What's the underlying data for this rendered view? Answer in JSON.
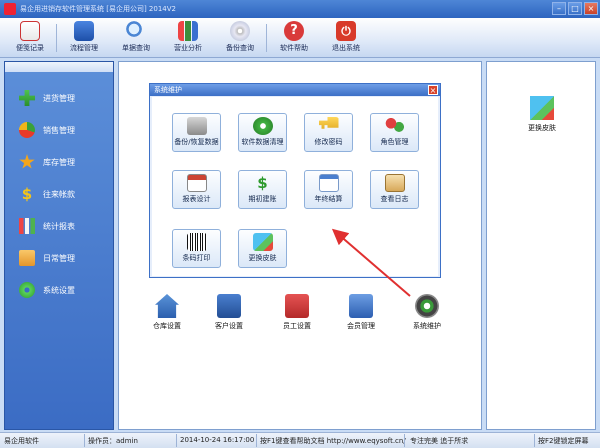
{
  "titlebar": {
    "title": "易企用进销存软件管理系统 [易企用公司] 2014V2"
  },
  "toolbar": {
    "buttons": [
      {
        "label": "便笺记录",
        "icon": "notepad-icon"
      },
      {
        "label": "流程管理",
        "icon": "flow-icon"
      },
      {
        "label": "单据查询",
        "icon": "search-icon"
      },
      {
        "label": "营业分析",
        "icon": "chart-icon"
      },
      {
        "label": "备份查询",
        "icon": "disc-icon"
      },
      {
        "label": "软件帮助",
        "icon": "help-icon"
      },
      {
        "label": "退出系统",
        "icon": "power-icon"
      }
    ]
  },
  "sidebar": {
    "items": [
      {
        "label": "进货管理",
        "icon": "plus-icon"
      },
      {
        "label": "销售管理",
        "icon": "pie-icon"
      },
      {
        "label": "库存管理",
        "icon": "star-icon"
      },
      {
        "label": "往来帐款",
        "icon": "dollar-icon"
      },
      {
        "label": "统计报表",
        "icon": "bar-chart-icon"
      },
      {
        "label": "日常管理",
        "icon": "folder-icon"
      },
      {
        "label": "系统设置",
        "icon": "gear-icon"
      }
    ]
  },
  "dialog": {
    "title": "系统维护",
    "close": "×",
    "buttons": [
      {
        "label": "备份/恢复数据",
        "icon": "database-icon"
      },
      {
        "label": "软件数据清理",
        "icon": "cleanup-icon"
      },
      {
        "label": "修改密码",
        "icon": "key-icon"
      },
      {
        "label": "角色管理",
        "icon": "users-icon"
      },
      {
        "label": "报表设计",
        "icon": "report-icon"
      },
      {
        "label": "期初建账",
        "icon": "money-icon"
      },
      {
        "label": "年终结算",
        "icon": "calendar-icon"
      },
      {
        "label": "查看日志",
        "icon": "log-icon"
      },
      {
        "label": "条码打印",
        "icon": "barcode-icon"
      },
      {
        "label": "更换皮肤",
        "icon": "skin-icon"
      }
    ]
  },
  "main": {
    "shortcuts": [
      {
        "label": "仓库设置",
        "icon": "warehouse-icon"
      },
      {
        "label": "客户设置",
        "icon": "customers-icon"
      },
      {
        "label": "员工设置",
        "icon": "staff-icon"
      },
      {
        "label": "会员管理",
        "icon": "members-icon"
      },
      {
        "label": "系统维护",
        "icon": "maintenance-icon"
      }
    ]
  },
  "rightpanel": {
    "label": "更换皮肤",
    "icon": "cubes-icon"
  },
  "statusbar": {
    "software": "易企用软件",
    "operator": "操作员：admin",
    "datetime": "2014-10-24 16:17:00",
    "help": "按F1键查看帮助文档 http://www.eqysoft.cn/",
    "slogan": "专注完美 追于所求",
    "lock": "按F2键锁定屏幕"
  },
  "colors": {
    "accent": "#3b6cc4",
    "arrow": "#e03030"
  }
}
